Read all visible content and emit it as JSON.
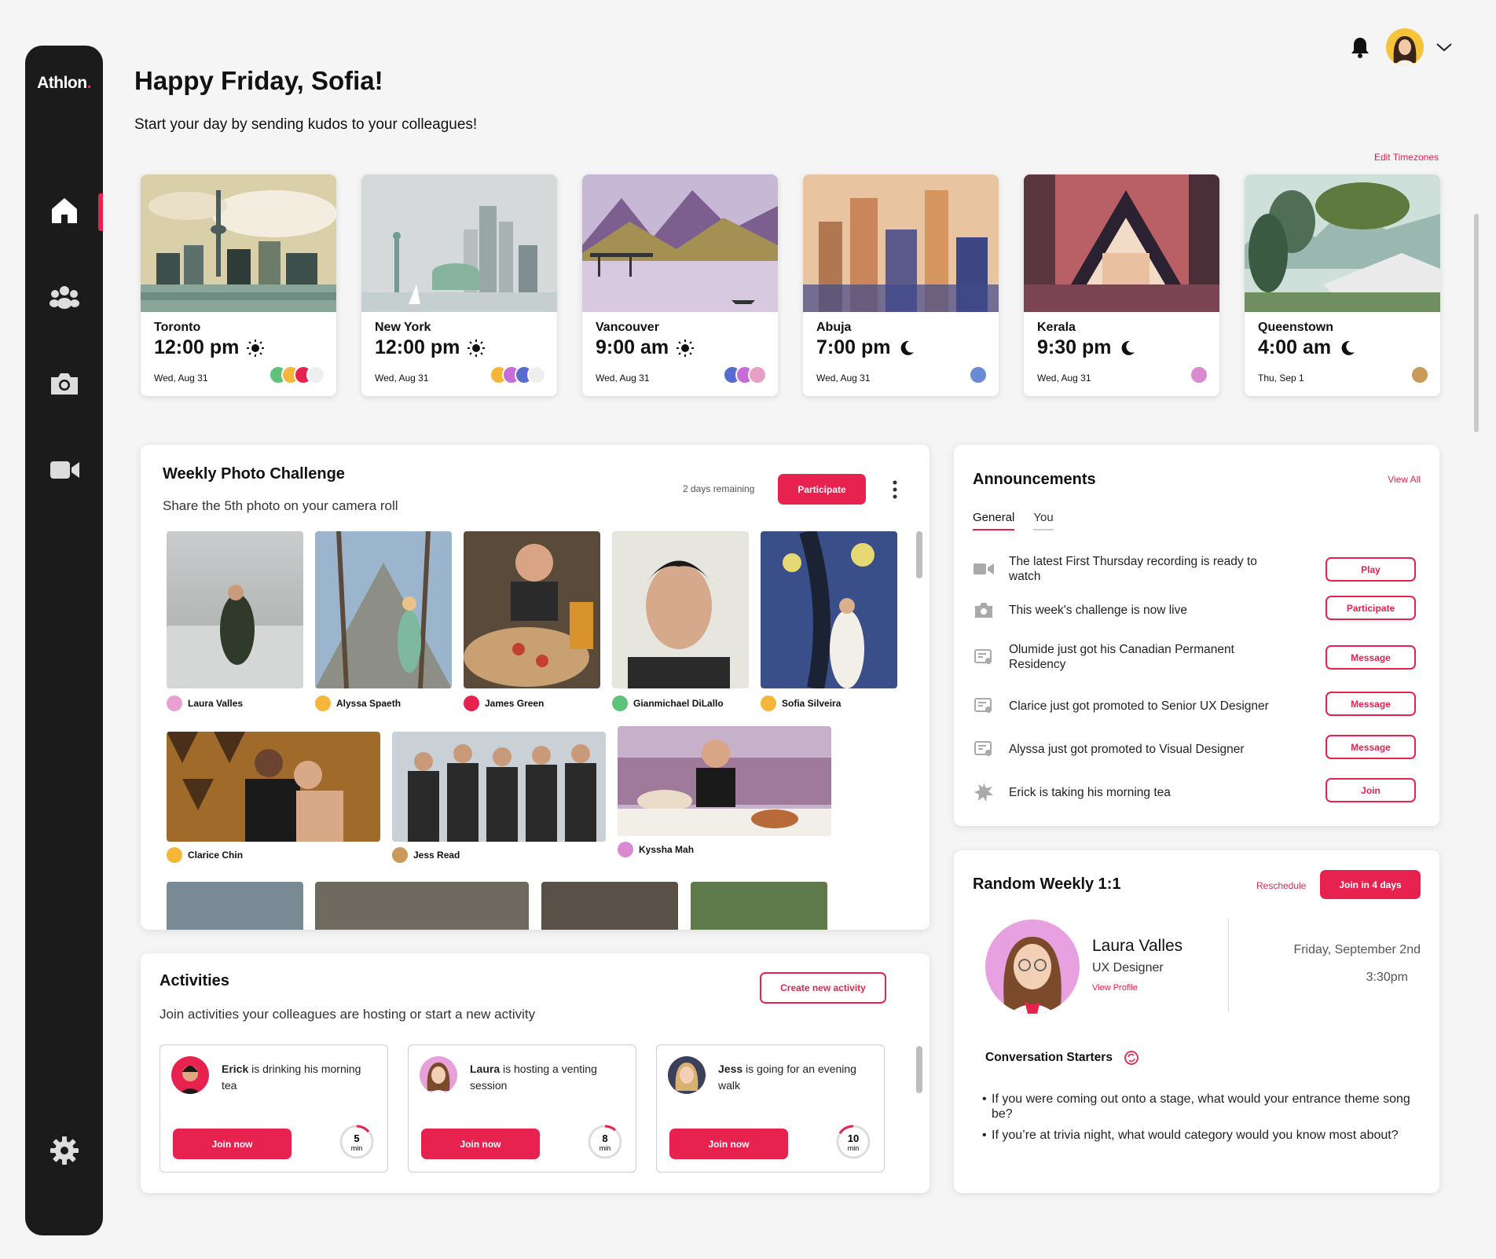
{
  "app": {
    "logo": "Athlon",
    "logo_dot": "."
  },
  "header": {
    "greeting": "Happy Friday, Sofia!",
    "subtitle": "Start your day by sending kudos to your colleagues!",
    "edit_timezones": "Edit Timezones"
  },
  "sidebar": {
    "items": [
      "home-icon",
      "team-icon",
      "camera-icon",
      "video-icon",
      "settings-icon"
    ],
    "active": "home"
  },
  "timezones": [
    {
      "city": "Toronto",
      "time": "12:00 pm",
      "icon": "sun",
      "date": "Wed, Aug 31"
    },
    {
      "city": "New York",
      "time": "12:00 pm",
      "icon": "sun",
      "date": "Wed, Aug 31"
    },
    {
      "city": "Vancouver",
      "time": "9:00 am",
      "icon": "sun",
      "date": "Wed, Aug 31"
    },
    {
      "city": "Abuja",
      "time": "7:00 pm",
      "icon": "moon",
      "date": "Wed, Aug 31"
    },
    {
      "city": "Kerala",
      "time": "9:30 pm",
      "icon": "moon",
      "date": "Wed, Aug 31"
    },
    {
      "city": "Queenstown",
      "time": "4:00 am",
      "icon": "moon",
      "date": "Thu, Sep 1"
    }
  ],
  "photo_challenge": {
    "title": "Weekly Photo Challenge",
    "subtitle": "Share the 5th photo on your camera roll",
    "remaining": "2 days remaining",
    "participate": "Participate",
    "row1": [
      "Laura Valles",
      "Alyssa Spaeth",
      "James Green",
      "Gianmichael DiLallo",
      "Sofia Silveira"
    ],
    "row2": [
      "Clarice Chin",
      "Jess Read",
      "Kyssha Mah"
    ]
  },
  "announcements": {
    "title": "Announcements",
    "view_all": "View All",
    "tabs": [
      "General",
      "You"
    ],
    "items": [
      {
        "icon": "video-icon",
        "text": "The latest First Thursday recording is ready to watch",
        "action": "Play"
      },
      {
        "icon": "camera-icon",
        "text": "This week's challenge is now live",
        "action": "Participate"
      },
      {
        "icon": "certificate-icon",
        "text": "Olumide just got his Canadian Permanent Residency",
        "action": "Message"
      },
      {
        "icon": "certificate-icon",
        "text": "Clarice just got promoted to Senior UX Designer",
        "action": "Message"
      },
      {
        "icon": "certificate-icon",
        "text": "Alyssa just got promoted to Visual Designer",
        "action": "Message"
      },
      {
        "icon": "starburst-icon",
        "text": "Erick is taking his morning tea",
        "action": "Join"
      }
    ]
  },
  "activities": {
    "title": "Activities",
    "subtitle": "Join activities your colleagues are hosting or start a new activity",
    "create": "Create new activity",
    "cards": [
      {
        "name": "Erick",
        "rest": " is drinking his morning tea",
        "join": "Join now",
        "minutes": "5",
        "unit": "min"
      },
      {
        "name": "Laura",
        "rest": " is hosting a venting session",
        "join": "Join now",
        "minutes": "8",
        "unit": "min"
      },
      {
        "name": "Jess",
        "rest": " is going for an evening walk",
        "join": "Join now",
        "minutes": "10",
        "unit": "min"
      }
    ]
  },
  "one_on_one": {
    "title": "Random Weekly 1:1",
    "reschedule": "Reschedule",
    "join": "Join in 4 days",
    "person": "Laura Valles",
    "role": "UX Designer",
    "view_profile": "View Profile",
    "date": "Friday, September 2nd",
    "time": "3:30pm",
    "starters_title": "Conversation Starters",
    "starters": [
      "If you were coming out onto a stage, what would your entrance theme song be?",
      "If you’re at trivia night, what would category would you know most about?"
    ]
  },
  "colors": {
    "accent": "#e8224f",
    "sidebar": "#1b1b1b",
    "background": "#f5f5f5"
  }
}
